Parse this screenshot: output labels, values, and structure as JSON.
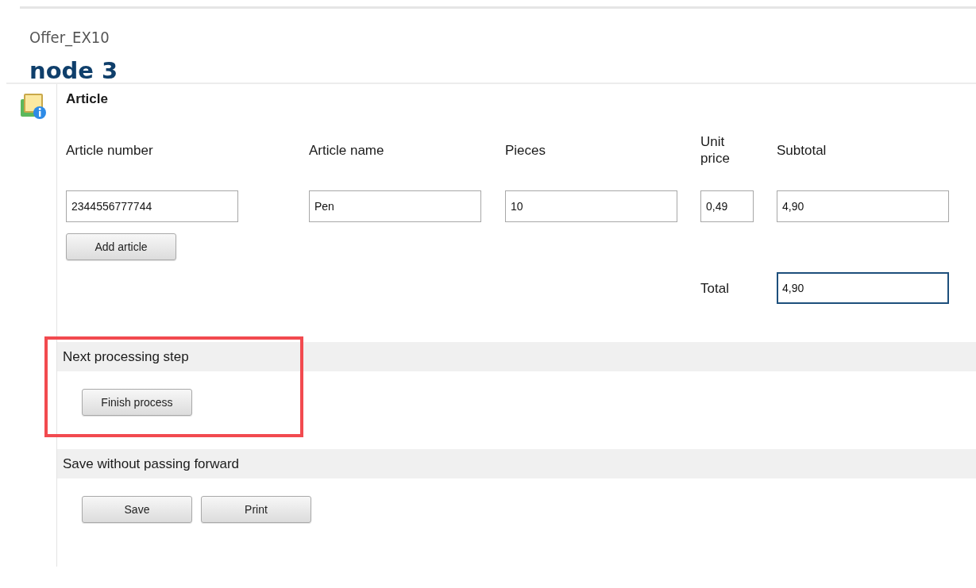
{
  "record": {
    "type_label": "Offer_EX10",
    "title": "node 3"
  },
  "article": {
    "heading": "Article",
    "columns": [
      "Article number",
      "Article name",
      "Pieces",
      "Unit price",
      "Subtotal"
    ],
    "rows": [
      [
        "2344556777744",
        "Pen",
        "10",
        "0,49",
        "4,90"
      ]
    ],
    "add_button": "Add article",
    "total_label": "Total",
    "total_value": "4,90",
    "total_focused": true
  },
  "sections": [
    {
      "heading": "Next processing step",
      "highlighted": true,
      "buttons": [
        "Finish process"
      ]
    },
    {
      "heading": "Save without passing forward",
      "highlighted": false,
      "buttons": [
        "Save",
        "Print"
      ]
    }
  ]
}
